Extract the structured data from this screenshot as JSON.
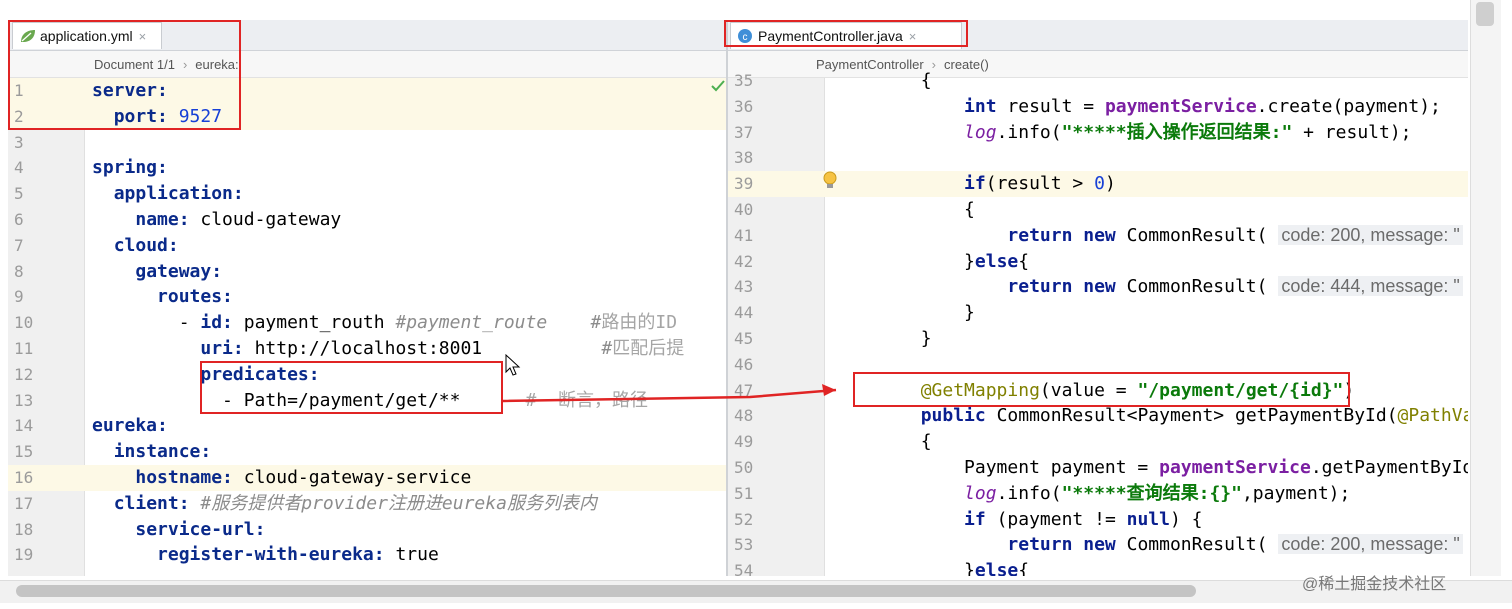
{
  "left": {
    "tab": "application.yml",
    "breadcrumb": [
      "Document 1/1",
      "eureka:"
    ],
    "lines": [
      {
        "n": "1",
        "t": [
          [
            "key",
            "server:"
          ]
        ]
      },
      {
        "n": "2",
        "t": [
          [
            "",
            "  "
          ],
          [
            "key",
            "port:"
          ],
          [
            "",
            ""
          ],
          [
            "num",
            " 9527"
          ]
        ]
      },
      {
        "n": "3",
        "t": []
      },
      {
        "n": "4",
        "t": [
          [
            "key",
            "spring:"
          ]
        ]
      },
      {
        "n": "5",
        "t": [
          [
            "",
            "  "
          ],
          [
            "key",
            "application:"
          ]
        ]
      },
      {
        "n": "6",
        "t": [
          [
            "",
            "    "
          ],
          [
            "key",
            "name:"
          ],
          [
            "",
            " cloud-gateway"
          ]
        ]
      },
      {
        "n": "7",
        "t": [
          [
            "",
            "  "
          ],
          [
            "key",
            "cloud:"
          ]
        ]
      },
      {
        "n": "8",
        "t": [
          [
            "",
            "    "
          ],
          [
            "key",
            "gateway:"
          ]
        ]
      },
      {
        "n": "9",
        "t": [
          [
            "",
            "      "
          ],
          [
            "key",
            "routes:"
          ]
        ]
      },
      {
        "n": "10",
        "t": [
          [
            "",
            "        - "
          ],
          [
            "key",
            "id:"
          ],
          [
            "",
            " payment_routh "
          ],
          [
            "cmt",
            "#payment_route    #"
          ],
          [
            "cmtp",
            "路由的ID"
          ]
        ]
      },
      {
        "n": "11",
        "t": [
          [
            "",
            "          "
          ],
          [
            "key",
            "uri:"
          ],
          [
            "",
            " http://localhost:8001           "
          ],
          [
            "cmt",
            "#"
          ],
          [
            "cmtp",
            "匹配后提"
          ]
        ]
      },
      {
        "n": "12",
        "t": [
          [
            "",
            "          "
          ],
          [
            "key",
            "predicates:"
          ]
        ]
      },
      {
        "n": "13",
        "t": [
          [
            "",
            "            - Path=/payment/get/**      "
          ],
          [
            "cmtp",
            "#  断言，路径"
          ]
        ]
      },
      {
        "n": "14",
        "t": [
          [
            "key",
            "eureka:"
          ]
        ]
      },
      {
        "n": "15",
        "t": [
          [
            "",
            "  "
          ],
          [
            "key",
            "instance:"
          ]
        ]
      },
      {
        "n": "16",
        "t": [
          [
            "",
            "    "
          ],
          [
            "key",
            "hostname:"
          ],
          [
            "",
            " cloud-gateway-service"
          ]
        ]
      },
      {
        "n": "17",
        "t": [
          [
            "",
            "  "
          ],
          [
            "key",
            "client:"
          ],
          [
            "",
            " "
          ],
          [
            "cmt",
            "#服务提供者provider注册进eureka服务列表内"
          ]
        ]
      },
      {
        "n": "18",
        "t": [
          [
            "",
            "    "
          ],
          [
            "key",
            "service-url:"
          ]
        ]
      },
      {
        "n": "19",
        "t": [
          [
            "",
            "      "
          ],
          [
            "key",
            "register-with-eureka:"
          ],
          [
            "",
            " true"
          ]
        ]
      }
    ]
  },
  "right": {
    "tab": "PaymentController.java",
    "breadcrumb": [
      "PaymentController",
      "create()"
    ],
    "lines": [
      {
        "n": "35",
        "t": [
          [
            "",
            "        {"
          ]
        ]
      },
      {
        "n": "36",
        "t": [
          [
            "",
            "            "
          ],
          [
            "kw",
            "int"
          ],
          [
            "",
            " result = "
          ],
          [
            "fld",
            "paymentService"
          ],
          [
            "",
            ".create(payment);"
          ]
        ]
      },
      {
        "n": "37",
        "t": [
          [
            "",
            "            "
          ],
          [
            "logv",
            "log"
          ],
          [
            "",
            ".info("
          ],
          [
            "str",
            "\"*****插入操作返回结果:\""
          ],
          [
            "",
            " + result);"
          ]
        ]
      },
      {
        "n": "38",
        "t": []
      },
      {
        "n": "39",
        "t": [
          [
            "",
            "            "
          ],
          [
            "kw",
            "if"
          ],
          [
            "",
            "(result > "
          ],
          [
            "num",
            "0"
          ],
          [
            "",
            ")"
          ]
        ]
      },
      {
        "n": "40",
        "t": [
          [
            "",
            "            {"
          ]
        ]
      },
      {
        "n": "41",
        "t": [
          [
            "",
            "                "
          ],
          [
            "kw",
            "return new"
          ],
          [
            "",
            " CommonResult( "
          ],
          [
            "hint",
            "code: 200, message: \""
          ]
        ]
      },
      {
        "n": "42",
        "t": [
          [
            "",
            "            }"
          ],
          [
            "kw",
            "else"
          ],
          [
            "",
            "{"
          ]
        ]
      },
      {
        "n": "43",
        "t": [
          [
            "",
            "                "
          ],
          [
            "kw",
            "return new"
          ],
          [
            "",
            " CommonResult( "
          ],
          [
            "hint",
            "code: 444, message: \""
          ]
        ]
      },
      {
        "n": "44",
        "t": [
          [
            "",
            "            }"
          ]
        ]
      },
      {
        "n": "45",
        "t": [
          [
            "",
            "        }"
          ]
        ]
      },
      {
        "n": "46",
        "t": []
      },
      {
        "n": "47",
        "t": [
          [
            "",
            "        "
          ],
          [
            "ann",
            "@GetMapping"
          ],
          [
            "",
            "(value = "
          ],
          [
            "str",
            "\"/payment/get/{id}\""
          ],
          [
            "",
            ")"
          ]
        ]
      },
      {
        "n": "48",
        "t": [
          [
            "",
            "        "
          ],
          [
            "kw",
            "public"
          ],
          [
            "",
            " CommonResult<Payment> getPaymentById("
          ],
          [
            "ann",
            "@PathVar"
          ]
        ]
      },
      {
        "n": "49",
        "t": [
          [
            "",
            "        {"
          ]
        ]
      },
      {
        "n": "50",
        "t": [
          [
            "",
            "            Payment payment = "
          ],
          [
            "fld",
            "paymentService"
          ],
          [
            "",
            ".getPaymentById("
          ]
        ]
      },
      {
        "n": "51",
        "t": [
          [
            "",
            "            "
          ],
          [
            "logv",
            "log"
          ],
          [
            "",
            ".info("
          ],
          [
            "str",
            "\"*****查询结果:{}\""
          ],
          [
            "",
            ",payment);"
          ]
        ]
      },
      {
        "n": "52",
        "t": [
          [
            "",
            "            "
          ],
          [
            "kw",
            "if"
          ],
          [
            "",
            " (payment != "
          ],
          [
            "kw",
            "null"
          ],
          [
            "",
            ") {"
          ]
        ]
      },
      {
        "n": "53",
        "t": [
          [
            "",
            "                "
          ],
          [
            "kw",
            "return new"
          ],
          [
            "",
            " CommonResult( "
          ],
          [
            "hint",
            "code: 200, message: \""
          ]
        ]
      },
      {
        "n": "54",
        "t": [
          [
            "",
            "            }"
          ],
          [
            "kw",
            "else"
          ],
          [
            "",
            "{"
          ]
        ]
      }
    ]
  },
  "watermark": "@稀土掘金技术社区"
}
